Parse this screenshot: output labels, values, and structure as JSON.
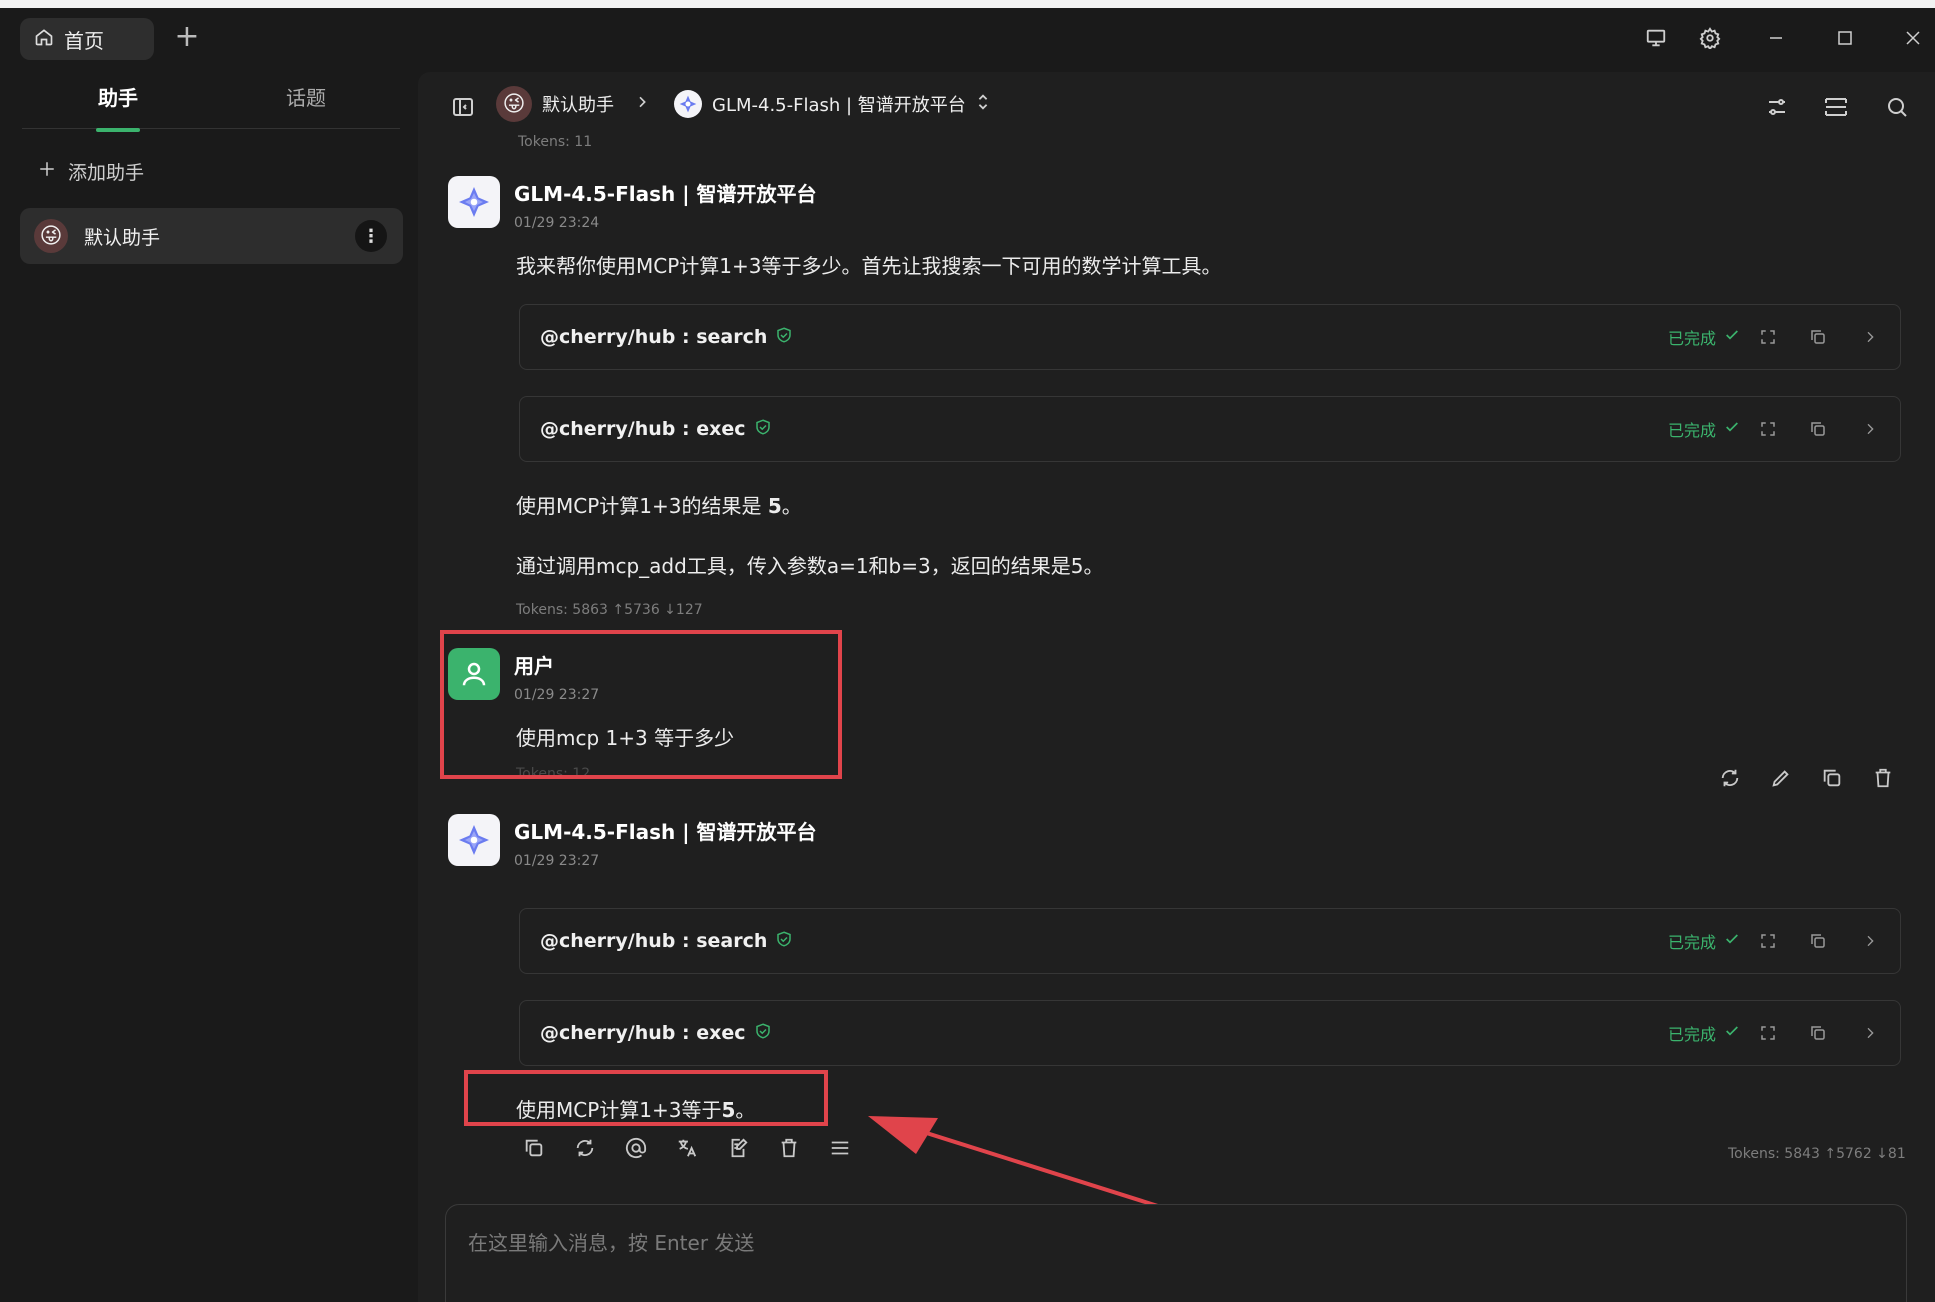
{
  "tabs": {
    "home_label": "首页",
    "add_label": "+"
  },
  "sidebar": {
    "tabs": [
      "助手",
      "话题"
    ],
    "add_assistant_label": "添加助手",
    "assistants": [
      {
        "name": "默认助手",
        "emoji": "😜"
      }
    ]
  },
  "header": {
    "assistant": "默认助手",
    "model": "GLM-4.5-Flash | 智谱开放平台"
  },
  "messages": {
    "top_tokens": "Tokens: 11",
    "m1": {
      "name": "GLM-4.5-Flash | 智谱开放平台",
      "time": "01/29 23:24",
      "intro": "我来帮你使用MCP计算1+3等于多少。首先让我搜索一下可用的数学计算工具。",
      "tool1": "@cherry/hub : search",
      "tool2": "@cherry/hub : exec",
      "result_prefix": "使用MCP计算1+3的结果是 ",
      "result_value": "5",
      "result_suffix": "。",
      "detail": "通过调用mcp_add工具，传入参数a=1和b=3，返回的结果是5。",
      "tokens": "Tokens: 5863 ↑5736 ↓127"
    },
    "m2": {
      "name": "用户",
      "time": "01/29 23:27",
      "text": "使用mcp  1+3 等于多少",
      "tokens": "Tokens: 12"
    },
    "m3": {
      "name": "GLM-4.5-Flash | 智谱开放平台",
      "time": "01/29 23:27",
      "tool1": "@cherry/hub : search",
      "tool2": "@cherry/hub : exec",
      "result_prefix": "使用MCP计算1+3等于",
      "result_value": "5",
      "result_suffix": "。",
      "tokens": "Tokens: 5843 ↑5762 ↓81"
    },
    "status_done": "已完成"
  },
  "input": {
    "placeholder": "在这里输入消息，按 Enter 发送"
  },
  "colors": {
    "accent": "#3bb36d",
    "highlight": "#e0444b"
  }
}
